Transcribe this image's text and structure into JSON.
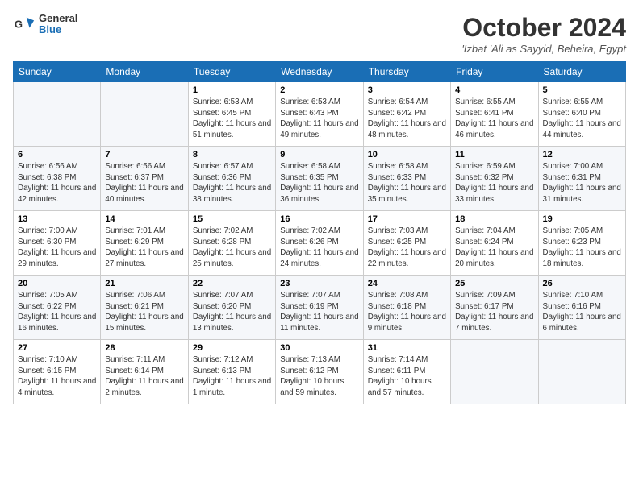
{
  "header": {
    "logo_line1": "General",
    "logo_line2": "Blue",
    "month_title": "October 2024",
    "location": "'Izbat 'Ali as Sayyid, Beheira, Egypt"
  },
  "weekdays": [
    "Sunday",
    "Monday",
    "Tuesday",
    "Wednesday",
    "Thursday",
    "Friday",
    "Saturday"
  ],
  "weeks": [
    [
      {
        "day": "",
        "detail": ""
      },
      {
        "day": "",
        "detail": ""
      },
      {
        "day": "1",
        "detail": "Sunrise: 6:53 AM\nSunset: 6:45 PM\nDaylight: 11 hours and 51 minutes."
      },
      {
        "day": "2",
        "detail": "Sunrise: 6:53 AM\nSunset: 6:43 PM\nDaylight: 11 hours and 49 minutes."
      },
      {
        "day": "3",
        "detail": "Sunrise: 6:54 AM\nSunset: 6:42 PM\nDaylight: 11 hours and 48 minutes."
      },
      {
        "day": "4",
        "detail": "Sunrise: 6:55 AM\nSunset: 6:41 PM\nDaylight: 11 hours and 46 minutes."
      },
      {
        "day": "5",
        "detail": "Sunrise: 6:55 AM\nSunset: 6:40 PM\nDaylight: 11 hours and 44 minutes."
      }
    ],
    [
      {
        "day": "6",
        "detail": "Sunrise: 6:56 AM\nSunset: 6:38 PM\nDaylight: 11 hours and 42 minutes."
      },
      {
        "day": "7",
        "detail": "Sunrise: 6:56 AM\nSunset: 6:37 PM\nDaylight: 11 hours and 40 minutes."
      },
      {
        "day": "8",
        "detail": "Sunrise: 6:57 AM\nSunset: 6:36 PM\nDaylight: 11 hours and 38 minutes."
      },
      {
        "day": "9",
        "detail": "Sunrise: 6:58 AM\nSunset: 6:35 PM\nDaylight: 11 hours and 36 minutes."
      },
      {
        "day": "10",
        "detail": "Sunrise: 6:58 AM\nSunset: 6:33 PM\nDaylight: 11 hours and 35 minutes."
      },
      {
        "day": "11",
        "detail": "Sunrise: 6:59 AM\nSunset: 6:32 PM\nDaylight: 11 hours and 33 minutes."
      },
      {
        "day": "12",
        "detail": "Sunrise: 7:00 AM\nSunset: 6:31 PM\nDaylight: 11 hours and 31 minutes."
      }
    ],
    [
      {
        "day": "13",
        "detail": "Sunrise: 7:00 AM\nSunset: 6:30 PM\nDaylight: 11 hours and 29 minutes."
      },
      {
        "day": "14",
        "detail": "Sunrise: 7:01 AM\nSunset: 6:29 PM\nDaylight: 11 hours and 27 minutes."
      },
      {
        "day": "15",
        "detail": "Sunrise: 7:02 AM\nSunset: 6:28 PM\nDaylight: 11 hours and 25 minutes."
      },
      {
        "day": "16",
        "detail": "Sunrise: 7:02 AM\nSunset: 6:26 PM\nDaylight: 11 hours and 24 minutes."
      },
      {
        "day": "17",
        "detail": "Sunrise: 7:03 AM\nSunset: 6:25 PM\nDaylight: 11 hours and 22 minutes."
      },
      {
        "day": "18",
        "detail": "Sunrise: 7:04 AM\nSunset: 6:24 PM\nDaylight: 11 hours and 20 minutes."
      },
      {
        "day": "19",
        "detail": "Sunrise: 7:05 AM\nSunset: 6:23 PM\nDaylight: 11 hours and 18 minutes."
      }
    ],
    [
      {
        "day": "20",
        "detail": "Sunrise: 7:05 AM\nSunset: 6:22 PM\nDaylight: 11 hours and 16 minutes."
      },
      {
        "day": "21",
        "detail": "Sunrise: 7:06 AM\nSunset: 6:21 PM\nDaylight: 11 hours and 15 minutes."
      },
      {
        "day": "22",
        "detail": "Sunrise: 7:07 AM\nSunset: 6:20 PM\nDaylight: 11 hours and 13 minutes."
      },
      {
        "day": "23",
        "detail": "Sunrise: 7:07 AM\nSunset: 6:19 PM\nDaylight: 11 hours and 11 minutes."
      },
      {
        "day": "24",
        "detail": "Sunrise: 7:08 AM\nSunset: 6:18 PM\nDaylight: 11 hours and 9 minutes."
      },
      {
        "day": "25",
        "detail": "Sunrise: 7:09 AM\nSunset: 6:17 PM\nDaylight: 11 hours and 7 minutes."
      },
      {
        "day": "26",
        "detail": "Sunrise: 7:10 AM\nSunset: 6:16 PM\nDaylight: 11 hours and 6 minutes."
      }
    ],
    [
      {
        "day": "27",
        "detail": "Sunrise: 7:10 AM\nSunset: 6:15 PM\nDaylight: 11 hours and 4 minutes."
      },
      {
        "day": "28",
        "detail": "Sunrise: 7:11 AM\nSunset: 6:14 PM\nDaylight: 11 hours and 2 minutes."
      },
      {
        "day": "29",
        "detail": "Sunrise: 7:12 AM\nSunset: 6:13 PM\nDaylight: 11 hours and 1 minute."
      },
      {
        "day": "30",
        "detail": "Sunrise: 7:13 AM\nSunset: 6:12 PM\nDaylight: 10 hours and 59 minutes."
      },
      {
        "day": "31",
        "detail": "Sunrise: 7:14 AM\nSunset: 6:11 PM\nDaylight: 10 hours and 57 minutes."
      },
      {
        "day": "",
        "detail": ""
      },
      {
        "day": "",
        "detail": ""
      }
    ]
  ]
}
